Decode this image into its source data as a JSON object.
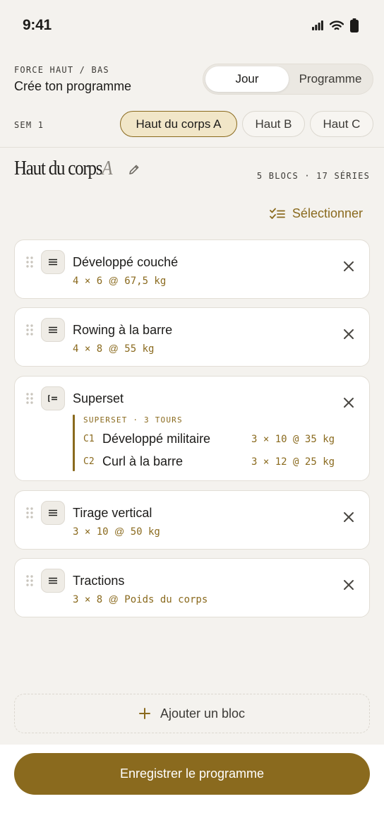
{
  "status_bar": {
    "time": "9:41"
  },
  "header": {
    "eyebrow": "FORCE HAUT / BAS",
    "title": "Crée ton programme",
    "segments": [
      {
        "label": "Jour",
        "selected": true
      },
      {
        "label": "Programme",
        "selected": false
      }
    ]
  },
  "week": {
    "label": "SEM 1",
    "days": [
      {
        "label": "Haut du corps A",
        "active": true
      },
      {
        "label": "Haut B",
        "active": false
      },
      {
        "label": "Haut C",
        "active": false
      }
    ]
  },
  "day": {
    "title_main": "Haut du corps",
    "title_suffix": "A",
    "stats": "5 BLOCS · 17 SÉRIES",
    "select_label": "Sélectionner"
  },
  "blocks": [
    {
      "name": "Développé couché",
      "sets": "4",
      "reps": "6",
      "load": "67,5 kg"
    },
    {
      "name": "Rowing à la barre",
      "sets": "4",
      "reps": "8",
      "load": "55 kg"
    },
    {
      "name": "Superset",
      "meta": "SUPERSET · 3 TOURS",
      "items": [
        {
          "code": "C1",
          "name": "Développé militaire",
          "sets": "3",
          "reps": "10",
          "load": "35 kg"
        },
        {
          "code": "C2",
          "name": "Curl à la barre",
          "sets": "3",
          "reps": "12",
          "load": "25 kg"
        }
      ]
    },
    {
      "name": "Tirage vertical",
      "sets": "3",
      "reps": "10",
      "load": "50 kg"
    },
    {
      "name": "Tractions",
      "sets": "3",
      "reps": "8",
      "load": "Poids du corps"
    }
  ],
  "add_block_label": "Ajouter un bloc",
  "save_label": "Enregistrer le programme",
  "symbols": {
    "times": "×",
    "at": "@"
  },
  "colors": {
    "accent": "#8a6a1e",
    "accent_light": "#f1e6c8",
    "background": "#f4f2ee",
    "card": "#ffffff"
  },
  "icons": {
    "status": [
      "signal-icon",
      "wifi-icon",
      "battery-icon"
    ],
    "edit": "pencil-icon",
    "select": "checklist-icon",
    "drag": "drag-handle-icon",
    "exercise_type": "list-icon",
    "superset_type": "superset-icon",
    "remove": "close-icon",
    "add": "plus-icon"
  }
}
